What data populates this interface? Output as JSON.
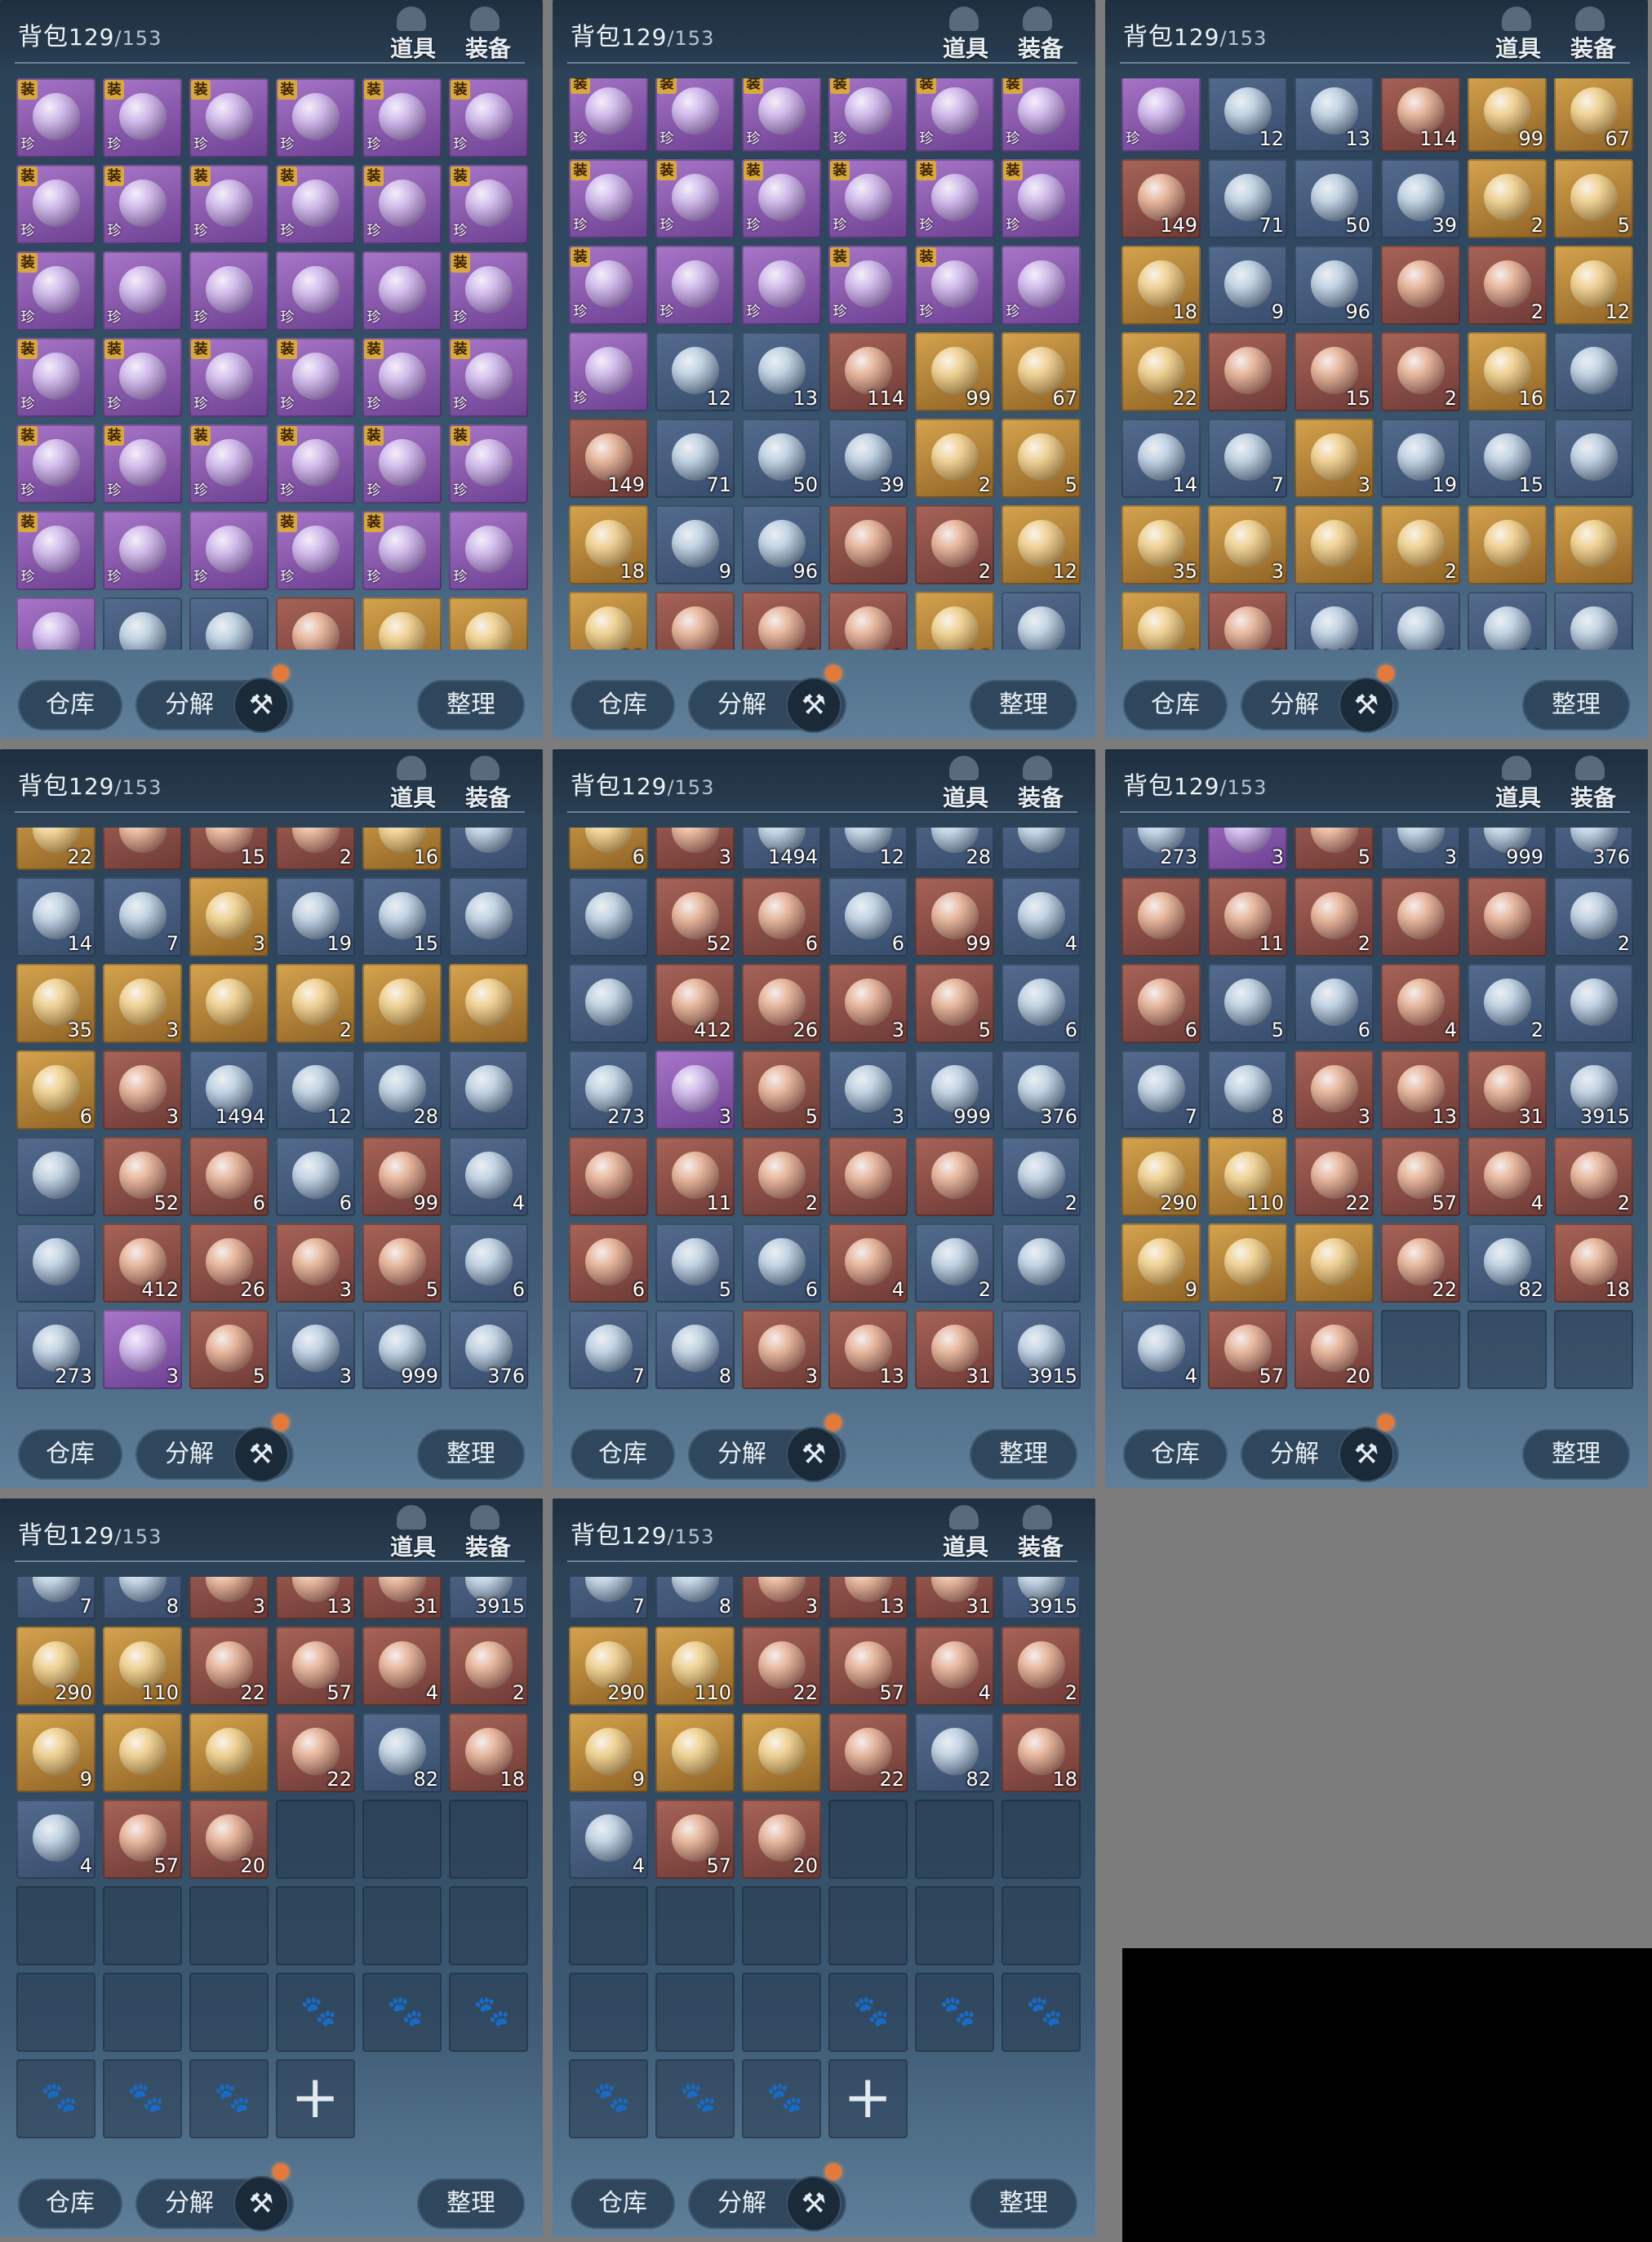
{
  "header": {
    "title": "背包",
    "count": "129",
    "capacity": "/153",
    "tab_props": "道具",
    "tab_equip": "装备"
  },
  "footer": {
    "warehouse": "仓库",
    "decompose": "分解",
    "sort": "整理"
  },
  "rows": {
    "r0": [
      [
        "p",
        "",
        "装",
        "珍"
      ],
      [
        "p",
        "",
        "装",
        "珍"
      ],
      [
        "p",
        "",
        "装",
        "珍"
      ],
      [
        "p",
        "",
        "装",
        "珍"
      ],
      [
        "p",
        "",
        "装",
        "珍"
      ],
      [
        "p",
        "",
        "装",
        "珍"
      ]
    ],
    "r1": [
      [
        "p",
        "",
        "装",
        "珍"
      ],
      [
        "p",
        "",
        "装",
        "珍"
      ],
      [
        "p",
        "",
        "装",
        "珍"
      ],
      [
        "p",
        "",
        "装",
        "珍"
      ],
      [
        "p",
        "",
        "装",
        "珍"
      ],
      [
        "p",
        "",
        "装",
        "珍"
      ]
    ],
    "r2": [
      [
        "p",
        "",
        "装",
        "珍"
      ],
      [
        "p",
        "",
        "",
        "珍"
      ],
      [
        "p",
        "",
        "",
        "珍"
      ],
      [
        "p",
        "",
        "",
        "珍"
      ],
      [
        "p",
        "",
        "",
        "珍"
      ],
      [
        "p",
        "",
        "装",
        "珍"
      ]
    ],
    "r3": [
      [
        "p",
        "",
        "装",
        "珍"
      ],
      [
        "p",
        "",
        "装",
        "珍"
      ],
      [
        "p",
        "",
        "装",
        "珍"
      ],
      [
        "p",
        "",
        "装",
        "珍"
      ],
      [
        "p",
        "",
        "装",
        "珍"
      ],
      [
        "p",
        "",
        "装",
        "珍"
      ]
    ],
    "r4": [
      [
        "p",
        "",
        "装",
        "珍"
      ],
      [
        "p",
        "",
        "装",
        "珍"
      ],
      [
        "p",
        "",
        "装",
        "珍"
      ],
      [
        "p",
        "",
        "装",
        "珍"
      ],
      [
        "p",
        "",
        "装",
        "珍"
      ],
      [
        "p",
        "",
        "装",
        "珍"
      ]
    ],
    "r5": [
      [
        "p",
        "",
        "装",
        "珍"
      ],
      [
        "p",
        "",
        "",
        "珍"
      ],
      [
        "p",
        "",
        "",
        "珍"
      ],
      [
        "p",
        "",
        "装",
        "珍"
      ],
      [
        "p",
        "",
        "装",
        "珍"
      ],
      [
        "p",
        "",
        "",
        "珍"
      ]
    ],
    "r6": [
      [
        "p",
        "",
        "",
        "珍"
      ],
      [
        "b",
        "12",
        "",
        ""
      ],
      [
        "b",
        "13",
        "",
        ""
      ],
      [
        "r",
        "114",
        "",
        ""
      ],
      [
        "g",
        "99",
        "",
        ""
      ],
      [
        "g",
        "67",
        "",
        ""
      ]
    ],
    "r7": [
      [
        "r",
        "149",
        "",
        ""
      ],
      [
        "b",
        "71",
        "",
        ""
      ],
      [
        "b",
        "50",
        "",
        ""
      ],
      [
        "b",
        "39",
        "",
        ""
      ],
      [
        "g",
        "2",
        "",
        ""
      ],
      [
        "g",
        "5",
        "",
        ""
      ]
    ],
    "r8": [
      [
        "g",
        "18",
        "",
        ""
      ],
      [
        "b",
        "9",
        "",
        ""
      ],
      [
        "b",
        "96",
        "",
        ""
      ],
      [
        "r",
        "",
        "",
        ""
      ],
      [
        "r",
        "2",
        "",
        ""
      ],
      [
        "g",
        "12",
        "",
        ""
      ]
    ],
    "r9": [
      [
        "g",
        "22",
        "",
        ""
      ],
      [
        "r",
        "",
        "",
        ""
      ],
      [
        "r",
        "15",
        "",
        ""
      ],
      [
        "r",
        "2",
        "",
        ""
      ],
      [
        "g",
        "16",
        "",
        ""
      ],
      [
        "b",
        "",
        "",
        ""
      ]
    ],
    "r10": [
      [
        "b",
        "14",
        "",
        ""
      ],
      [
        "b",
        "7",
        "",
        ""
      ],
      [
        "g",
        "3",
        "",
        ""
      ],
      [
        "b",
        "19",
        "",
        ""
      ],
      [
        "b",
        "15",
        "",
        ""
      ],
      [
        "b",
        "",
        "",
        ""
      ]
    ],
    "r11": [
      [
        "g",
        "35",
        "",
        ""
      ],
      [
        "g",
        "3",
        "",
        ""
      ],
      [
        "g",
        "",
        "",
        ""
      ],
      [
        "g",
        "2",
        "",
        ""
      ],
      [
        "g",
        "",
        "",
        ""
      ],
      [
        "g",
        "",
        "",
        ""
      ]
    ],
    "r12": [
      [
        "g",
        "6",
        "",
        ""
      ],
      [
        "r",
        "3",
        "",
        ""
      ],
      [
        "b",
        "1494",
        "",
        ""
      ],
      [
        "b",
        "12",
        "",
        ""
      ],
      [
        "b",
        "28",
        "",
        ""
      ],
      [
        "b",
        "",
        "",
        ""
      ]
    ],
    "r13": [
      [
        "b",
        "",
        "",
        ""
      ],
      [
        "r",
        "52",
        "",
        ""
      ],
      [
        "r",
        "6",
        "",
        ""
      ],
      [
        "b",
        "6",
        "",
        ""
      ],
      [
        "r",
        "99",
        "",
        ""
      ],
      [
        "b",
        "4",
        "",
        ""
      ]
    ],
    "r14": [
      [
        "b",
        "",
        "",
        ""
      ],
      [
        "r",
        "412",
        "",
        ""
      ],
      [
        "r",
        "26",
        "",
        ""
      ],
      [
        "r",
        "3",
        "",
        ""
      ],
      [
        "r",
        "5",
        "",
        ""
      ],
      [
        "b",
        "6",
        "",
        ""
      ]
    ],
    "r15": [
      [
        "b",
        "273",
        "",
        ""
      ],
      [
        "p",
        "3",
        "",
        ""
      ],
      [
        "r",
        "5",
        "",
        ""
      ],
      [
        "b",
        "3",
        "",
        ""
      ],
      [
        "b",
        "999",
        "",
        ""
      ],
      [
        "b",
        "376",
        "",
        ""
      ]
    ],
    "r16": [
      [
        "r",
        "",
        "",
        ""
      ],
      [
        "r",
        "11",
        "",
        ""
      ],
      [
        "r",
        "2",
        "",
        ""
      ],
      [
        "r",
        "",
        "",
        ""
      ],
      [
        "r",
        "",
        "",
        ""
      ],
      [
        "b",
        "2",
        "",
        ""
      ]
    ],
    "r17": [
      [
        "r",
        "6",
        "",
        ""
      ],
      [
        "b",
        "5",
        "",
        ""
      ],
      [
        "b",
        "6",
        "",
        ""
      ],
      [
        "r",
        "4",
        "",
        ""
      ],
      [
        "b",
        "2",
        "",
        ""
      ],
      [
        "b",
        "",
        "",
        ""
      ]
    ],
    "r18": [
      [
        "b",
        "7",
        "",
        ""
      ],
      [
        "b",
        "8",
        "",
        ""
      ],
      [
        "r",
        "3",
        "",
        ""
      ],
      [
        "r",
        "13",
        "",
        ""
      ],
      [
        "r",
        "31",
        "",
        ""
      ],
      [
        "b",
        "3915",
        "",
        ""
      ]
    ],
    "r19": [
      [
        "g",
        "290",
        "",
        ""
      ],
      [
        "g",
        "110",
        "",
        ""
      ],
      [
        "r",
        "22",
        "",
        ""
      ],
      [
        "r",
        "57",
        "",
        ""
      ],
      [
        "r",
        "4",
        "",
        ""
      ],
      [
        "r",
        "2",
        "",
        ""
      ]
    ],
    "r20": [
      [
        "g",
        "9",
        "",
        ""
      ],
      [
        "g",
        "",
        "",
        " "
      ],
      [
        "g",
        "",
        "",
        ""
      ],
      [
        "r",
        "22",
        "",
        ""
      ],
      [
        "b",
        "82",
        "",
        ""
      ],
      [
        "r",
        "18",
        "",
        ""
      ]
    ],
    "r21": [
      [
        "b",
        "4",
        "",
        ""
      ],
      [
        "r",
        "57",
        "",
        ""
      ],
      [
        "r",
        "20",
        "",
        ""
      ],
      [
        "e",
        "",
        "",
        ""
      ],
      [
        "e",
        "",
        "",
        ""
      ],
      [
        "e",
        "",
        "",
        ""
      ]
    ],
    "r22": [
      [
        "e",
        "",
        "",
        ""
      ],
      [
        "e",
        "",
        "",
        ""
      ],
      [
        "e",
        "",
        "",
        ""
      ],
      [
        "e",
        "",
        "",
        ""
      ],
      [
        "e",
        "",
        "",
        ""
      ],
      [
        "e",
        "",
        "",
        ""
      ]
    ],
    "r23": [
      [
        "e",
        "",
        "",
        ""
      ],
      [
        "e",
        "",
        "",
        ""
      ],
      [
        "e",
        "",
        "",
        ""
      ],
      [
        "l",
        "",
        "",
        ""
      ],
      [
        "l",
        "",
        "",
        ""
      ],
      [
        "l",
        "",
        "",
        ""
      ]
    ],
    "r24": [
      [
        "l",
        "",
        "",
        ""
      ],
      [
        "l",
        "",
        "",
        ""
      ],
      [
        "l",
        "",
        "",
        ""
      ],
      [
        "plus",
        "",
        "",
        ""
      ],
      [
        "x",
        "",
        "",
        ""
      ],
      [
        "x",
        "",
        "",
        ""
      ]
    ]
  },
  "labels": {
    "plus": "+",
    "paw": "🐾",
    "hammer": "⚒"
  }
}
